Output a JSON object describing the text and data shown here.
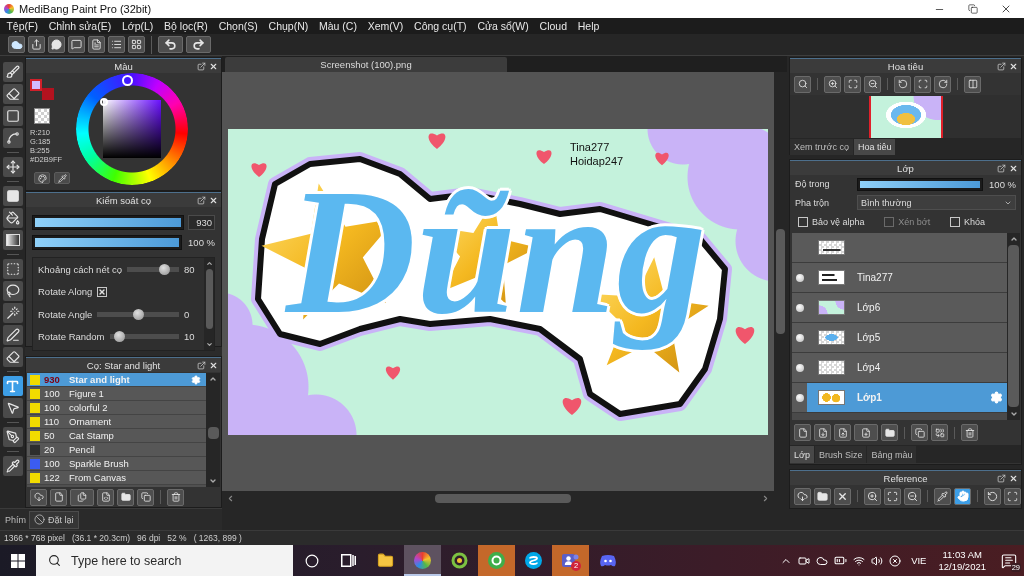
{
  "window": {
    "title": "MediBang Paint Pro (32bit)"
  },
  "menu": [
    "Tệp(F)",
    "Chỉnh sửa(E)",
    "Lớp(L)",
    "Bộ lọc(R)",
    "Chọn(S)",
    "Chụp(N)",
    "Màu (C)",
    "Xem(V)",
    "Công cụ(T)",
    "Cửa sổ(W)",
    "Cloud",
    "Help"
  ],
  "tool_groups": [
    {
      "tools": [
        {
          "kind": "brush",
          "selected": false
        },
        {
          "kind": "eraser",
          "selected": false
        },
        {
          "kind": "dot",
          "selected": false
        },
        {
          "kind": "polyline",
          "selected": false
        }
      ]
    },
    {
      "tools": [
        {
          "kind": "move",
          "selected": false
        }
      ]
    },
    {
      "tools": [
        {
          "kind": "fill",
          "selected": false
        },
        {
          "kind": "bucket",
          "selected": false
        },
        {
          "kind": "gradient",
          "selected": false
        }
      ]
    },
    {
      "tools": [
        {
          "kind": "select",
          "selected": false
        },
        {
          "kind": "lasso",
          "selected": false
        },
        {
          "kind": "wand",
          "selected": false
        },
        {
          "kind": "select_pen",
          "selected": false
        },
        {
          "kind": "select_eraser",
          "selected": false
        }
      ]
    },
    {
      "tools": [
        {
          "kind": "text",
          "selected": true
        },
        {
          "kind": "operation",
          "selected": false
        }
      ]
    },
    {
      "tools": [
        {
          "kind": "pen",
          "selected": false
        }
      ]
    },
    {
      "tools": [
        {
          "kind": "eyedropper",
          "selected": false
        }
      ]
    }
  ],
  "color_panel": {
    "title": "Màu",
    "swatches": [
      {
        "color": "#d2b9ff"
      },
      {
        "color": "#b3121f"
      }
    ],
    "readout": [
      "R:210",
      "G:185",
      "B:255",
      "#D2B9FF"
    ]
  },
  "brush_control": {
    "title": "Kiểm soát cọ",
    "size": {
      "level": 1,
      "value": "930"
    },
    "opacity": {
      "level": 1,
      "value": "100 %"
    },
    "settings": [
      {
        "kind": "slider",
        "label": "Khoảng cách nét cọ",
        "level": 0.78,
        "value": "80"
      },
      {
        "kind": "checkbox",
        "label": "Rotate Along",
        "checked": true
      },
      {
        "kind": "slider",
        "label": "Rotate Angle",
        "level": 0.5,
        "value": "0"
      },
      {
        "kind": "slider",
        "label": "Rotate Random",
        "level": 0.08,
        "value": "10"
      }
    ]
  },
  "brush_list": {
    "title": "Cọ: Star and light",
    "items": [
      {
        "size": "930",
        "name": "Star and light",
        "color": "#f2dc00",
        "selected": true
      },
      {
        "size": "100",
        "name": "Figure 1",
        "color": "#f2dc00",
        "selected": false
      },
      {
        "size": "100",
        "name": "colorful 2",
        "color": "#f2dc00",
        "selected": false
      },
      {
        "size": "110",
        "name": "Ornament",
        "color": "#f2dc00",
        "selected": false
      },
      {
        "size": "50",
        "name": "Cat Stamp",
        "color": "#f2dc00",
        "selected": false
      },
      {
        "size": "20",
        "name": "Pencil",
        "color": "#2e2e2e",
        "selected": false
      },
      {
        "size": "100",
        "name": "Sparkle Brush",
        "color": "#3b5cf0",
        "selected": false
      },
      {
        "size": "122",
        "name": "From Canvas",
        "color": "#f2dc00",
        "selected": false
      }
    ]
  },
  "shortcut_bar": {
    "label": "Phím",
    "button": "Đặt lại"
  },
  "document": {
    "tab": "Screenshot (100).png",
    "lettering": "Dũng",
    "canvas_texts": [
      "Tina277",
      "Hoidap247"
    ]
  },
  "navigator": {
    "title": "Hoa tiêu",
    "tabs": [
      {
        "label": "Xem trước cọ",
        "selected": false
      },
      {
        "label": "Hoa tiêu",
        "selected": true
      }
    ]
  },
  "layers": {
    "title": "Lớp",
    "opacity": {
      "label": "Độ trong",
      "level": 1,
      "value": "100 %"
    },
    "blend": {
      "label": "Pha trộn",
      "value": "Bình thường"
    },
    "options": [
      {
        "label": "Bảo vệ alpha",
        "checked": false,
        "disabled": false
      },
      {
        "label": "Xén bớt",
        "checked": false,
        "disabled": true
      },
      {
        "label": "Khóa",
        "checked": false,
        "disabled": false
      }
    ],
    "items": [
      {
        "visible": false,
        "selected": false
      },
      {
        "name": "Tina277",
        "visible": true,
        "selected": false
      },
      {
        "name": "Lớp6",
        "visible": true,
        "selected": false
      },
      {
        "name": "Lớp5",
        "visible": true,
        "selected": false
      },
      {
        "name": "Lớp4",
        "visible": true,
        "selected": false
      },
      {
        "name": "Lớp1",
        "visible": true,
        "selected": true
      }
    ],
    "tabs": [
      {
        "label": "Lớp",
        "selected": true
      },
      {
        "label": "Brush Size",
        "selected": false
      },
      {
        "label": "Bảng màu",
        "selected": false
      }
    ]
  },
  "reference": {
    "title": "Reference",
    "tool_groups": [
      {
        "tools": [
          {
            "kind": "import",
            "selected": false
          },
          {
            "kind": "open",
            "selected": false
          },
          {
            "kind": "close",
            "selected": false
          }
        ]
      },
      {
        "tools": [
          {
            "kind": "zoom_in",
            "selected": false
          },
          {
            "kind": "fit",
            "selected": false
          },
          {
            "kind": "zoom_out",
            "selected": false
          }
        ]
      },
      {
        "tools": [
          {
            "kind": "eyedropper",
            "selected": false
          },
          {
            "kind": "hand",
            "selected": true
          }
        ]
      },
      {
        "tools": [
          {
            "kind": "rotate",
            "selected": false
          },
          {
            "kind": "frame",
            "selected": false
          }
        ]
      }
    ]
  },
  "status_bar": [
    "1366 * 768 pixel",
    "(36.1 * 20.3cm)",
    "96 dpi",
    "52 %",
    "( 1263, 899 )"
  ],
  "taskbar": {
    "search": {
      "placeholder": "Type here to search"
    },
    "apps": [
      {
        "kind": "cortana",
        "active": false,
        "flashing": false
      },
      {
        "kind": "task_view",
        "active": false,
        "flashing": false
      },
      {
        "kind": "file_explorer",
        "active": false,
        "flashing": false
      },
      {
        "kind": "paint_app",
        "active": true,
        "flashing": false
      },
      {
        "kind": "ring_app",
        "active": false,
        "flashing": false
      },
      {
        "kind": "orb_app",
        "active": false,
        "flashing": true
      },
      {
        "kind": "chat_app",
        "active": false,
        "flashing": false
      },
      {
        "kind": "team_app",
        "active": false,
        "flashing": true,
        "badge": "2"
      },
      {
        "kind": "game_chat",
        "active": false,
        "flashing": false
      }
    ],
    "tray": {
      "language": "VIE",
      "time": "11:03 AM",
      "date": "12/19/2021",
      "notifications": "29"
    }
  }
}
